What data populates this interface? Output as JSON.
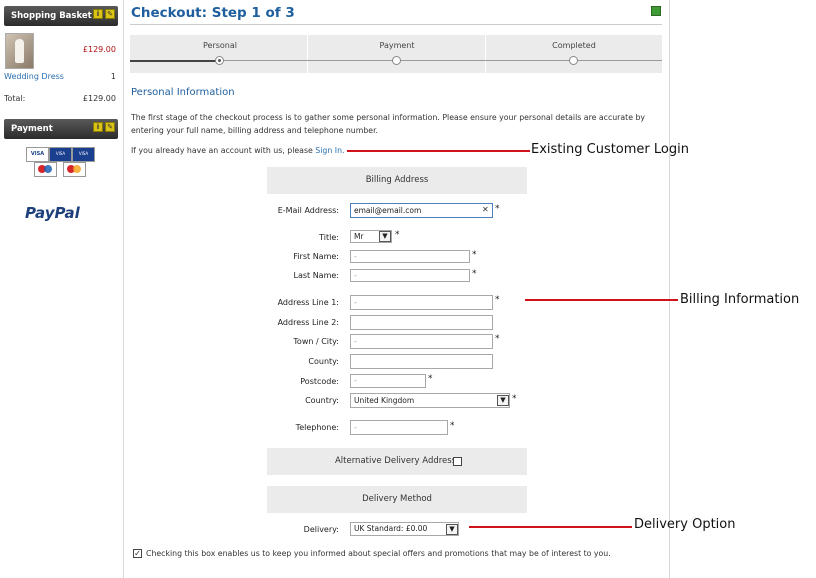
{
  "sidebar": {
    "basket_title": "Shopping Basket",
    "basket_item": {
      "name": "Wedding Dress",
      "price": "£129.00",
      "qty": "1"
    },
    "total_label": "Total:",
    "total_value": "£129.00",
    "payment_title": "Payment",
    "paypal": "PayPal",
    "cards": [
      "VISA",
      "VISA Delta",
      "VISA Electron",
      "Maestro",
      "Mastercard"
    ]
  },
  "main": {
    "title": "Checkout: Step 1 of 3",
    "steps": [
      {
        "label": "Personal",
        "active": true
      },
      {
        "label": "Payment",
        "active": false
      },
      {
        "label": "Completed",
        "active": false
      }
    ],
    "section_title": "Personal Information",
    "intro": "The first stage of the checkout process is to gather some personal information. Please ensure your personal details are accurate by entering your full name, billing address and telephone number.",
    "signin_prefix": "If you already have an account with us, please ",
    "signin_link": "Sign In.",
    "billing_header": "Billing Address",
    "fields": {
      "email": {
        "label": "E-Mail Address:",
        "value": "email@email.com"
      },
      "title": {
        "label": "Title:",
        "value": "Mr"
      },
      "first_name": {
        "label": "First Name:",
        "value": "-"
      },
      "last_name": {
        "label": "Last Name:",
        "value": "-"
      },
      "address1": {
        "label": "Address Line 1:",
        "value": "-"
      },
      "address2": {
        "label": "Address Line 2:",
        "value": ""
      },
      "town": {
        "label": "Town / City:",
        "value": "-"
      },
      "county": {
        "label": "County:",
        "value": ""
      },
      "postcode": {
        "label": "Postcode:",
        "value": "-"
      },
      "country": {
        "label": "Country:",
        "value": "United Kingdom"
      },
      "telephone": {
        "label": "Telephone:",
        "value": "-"
      }
    },
    "required_mark": "*",
    "alt_delivery_label": "Alternative Delivery Address:",
    "delivery_header": "Delivery Method",
    "delivery_label": "Delivery:",
    "delivery_value": "UK Standard:  £0.00",
    "newsletter_text": "Checking this box enables us to keep you informed about special offers and promotions that may be of interest to you."
  },
  "annotations": {
    "login": "Existing Customer Login",
    "billing": "Billing Information",
    "delivery": "Delivery Option"
  },
  "colors": {
    "title_blue": "#1f5f9e",
    "link_blue": "#2a6fb0",
    "price_red": "#b01010",
    "annotation_red": "#d0121b"
  }
}
